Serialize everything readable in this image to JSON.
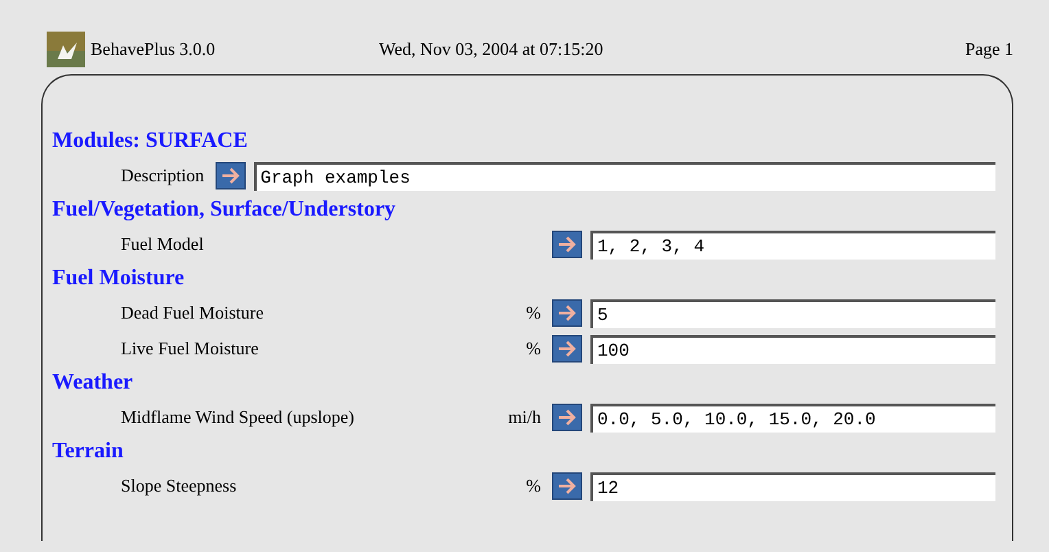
{
  "header": {
    "app": "BehavePlus 3.0.0",
    "date": "Wed, Nov 03, 2004 at 07:15:20",
    "page": "Page 1"
  },
  "sections": [
    {
      "title": "Modules: SURFACE",
      "rows": [
        {
          "kind": "inline",
          "label": "Description",
          "value": "Graph examples"
        }
      ]
    },
    {
      "title": "Fuel/Vegetation, Surface/Understory",
      "rows": [
        {
          "kind": "column",
          "label": "Fuel Model",
          "value": "1, 2, 3, 4"
        }
      ]
    },
    {
      "title": "Fuel Moisture",
      "rows": [
        {
          "kind": "column",
          "label": "Dead Fuel Moisture",
          "units": "%",
          "value": "5"
        },
        {
          "kind": "column",
          "label": "Live Fuel Moisture",
          "units": "%",
          "value": "100"
        }
      ]
    },
    {
      "title": "Weather",
      "rows": [
        {
          "kind": "column",
          "label": "Midflame Wind Speed (upslope)",
          "units": "mi/h",
          "value": "0.0, 5.0, 10.0, 15.0, 20.0"
        }
      ]
    },
    {
      "title": "Terrain",
      "rows": [
        {
          "kind": "column",
          "label": "Slope Steepness",
          "units": "%",
          "value": "12"
        }
      ]
    }
  ]
}
